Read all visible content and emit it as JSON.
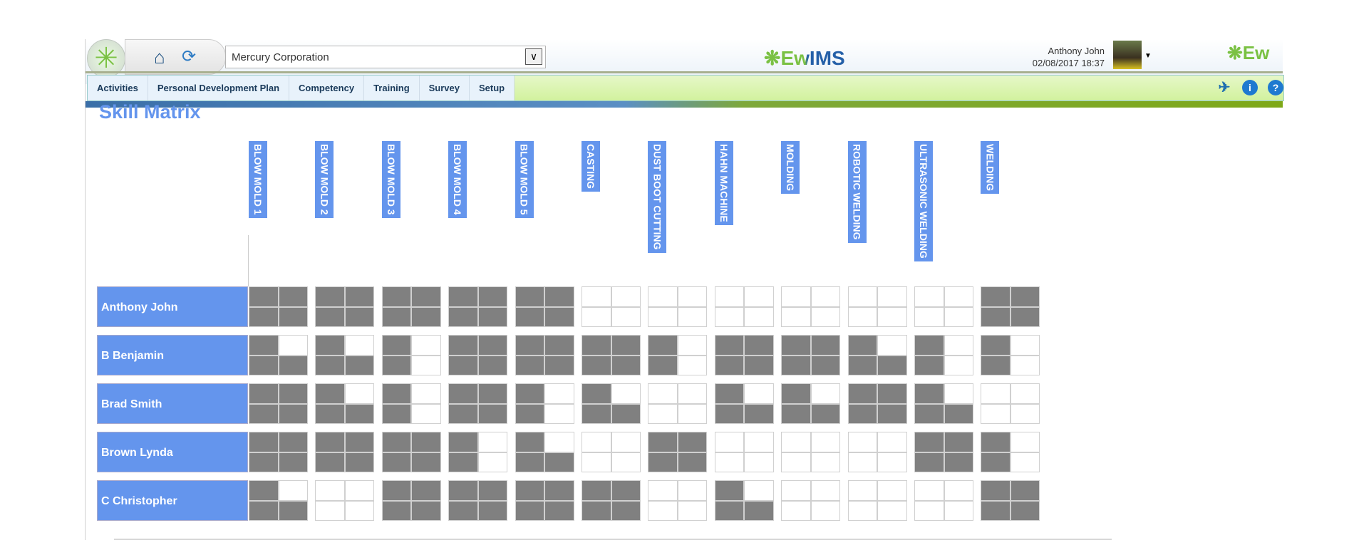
{
  "header": {
    "org_select": "Mercury Corporation",
    "brand": "EwIMS",
    "user_name": "Anthony John",
    "datetime": "02/08/2017 18:37",
    "brand_right": "Ew"
  },
  "nav": {
    "items": [
      "Activities",
      "Personal Development Plan",
      "Competency",
      "Training",
      "Survey",
      "Setup"
    ]
  },
  "page": {
    "title": "Skill Matrix"
  },
  "colors": {
    "accent": "#6495ED",
    "filled": "#808080"
  },
  "matrix": {
    "skills": [
      "BLOW MOLD 1",
      "BLOW MOLD 2",
      "BLOW MOLD 3",
      "BLOW MOLD 4",
      "BLOW MOLD 5",
      "CASTING",
      "DUST BOOT CUTTING",
      "HAHN MACHINE",
      "MOLDING",
      "ROBOTIC WELDING",
      "ULTRASONIC WELDING",
      "WELDING"
    ],
    "employees": [
      {
        "name": "Anthony John",
        "levels": [
          4,
          4,
          4,
          4,
          4,
          0,
          0,
          0,
          0,
          0,
          0,
          4
        ]
      },
      {
        "name": "B Benjamin",
        "levels": [
          3,
          3,
          2,
          4,
          4,
          4,
          2,
          4,
          4,
          3,
          2,
          2
        ]
      },
      {
        "name": "Brad Smith",
        "levels": [
          4,
          3,
          2,
          4,
          2,
          3,
          0,
          3,
          3,
          4,
          3,
          0
        ]
      },
      {
        "name": "Brown Lynda",
        "levels": [
          4,
          4,
          4,
          2,
          3,
          0,
          4,
          0,
          0,
          0,
          4,
          2
        ]
      },
      {
        "name": "C Christopher",
        "levels": [
          3,
          0,
          4,
          4,
          4,
          4,
          0,
          3,
          0,
          0,
          0,
          4
        ]
      }
    ],
    "max_level": 4
  }
}
